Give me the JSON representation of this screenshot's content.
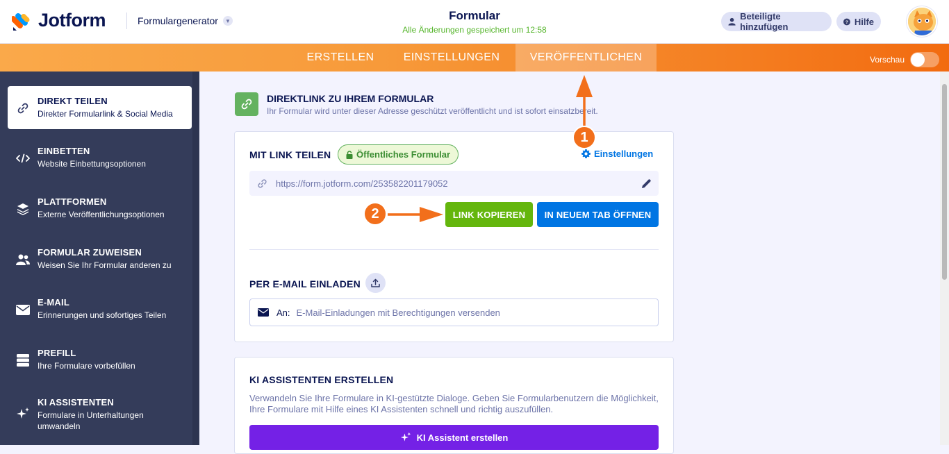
{
  "header": {
    "brand": "Jotform",
    "form_generator": "Formulargenerator",
    "title": "Formular",
    "saved_status": "Alle Änderungen gespeichert um 12:58",
    "add_participants": "Beteiligte hinzufügen",
    "help": "Hilfe"
  },
  "nav": {
    "tabs": [
      {
        "label": "ERSTELLEN"
      },
      {
        "label": "EINSTELLUNGEN"
      },
      {
        "label": "VERÖFFENTLICHEN"
      }
    ],
    "active_tab": "VERÖFFENTLICHEN",
    "preview_label": "Vorschau"
  },
  "sidebar": {
    "items": [
      {
        "title": "DIREKT TEILEN",
        "subtitle": "Direkter Formularlink & Social Media",
        "icon": "link-icon"
      },
      {
        "title": "EINBETTEN",
        "subtitle": "Website Einbettungsoptionen",
        "icon": "code-icon"
      },
      {
        "title": "PLATTFORMEN",
        "subtitle": "Externe Veröffentlichungsoptionen",
        "icon": "layers-icon"
      },
      {
        "title": "FORMULAR ZUWEISEN",
        "subtitle": "Weisen Sie Ihr Formular anderen zu",
        "icon": "users-icon"
      },
      {
        "title": "E-MAIL",
        "subtitle": "Erinnerungen und sofortiges Teilen",
        "icon": "envelope-icon"
      },
      {
        "title": "PREFILL",
        "subtitle": "Ihre Formulare vorbefüllen",
        "icon": "stack-icon"
      },
      {
        "title": "KI ASSISTENTEN",
        "subtitle": "Formulare in Unterhaltungen umwandeln",
        "icon": "sparkle-icon"
      }
    ]
  },
  "main": {
    "header_title": "DIREKTLINK ZU IHREM FORMULAR",
    "header_subtitle": "Ihr Formular wird unter dieser Adresse geschützt veröffentlicht und ist sofort einsatzbereit.",
    "share_title": "MIT LINK TEILEN",
    "public_badge": "Öffentliches Formular",
    "settings_link": "Einstellungen",
    "form_url": "https://form.jotform.com/253582201179052",
    "copy_link": "LINK KOPIEREN",
    "open_new_tab": "IN NEUEM TAB ÖFFNEN",
    "email_title": "PER E-MAIL EINLADEN",
    "email_to_label": "An:",
    "email_placeholder": "E-Mail-Einladungen mit Berechtigungen versenden",
    "ki_title": "KI ASSISTENTEN ERSTELLEN",
    "ki_description": "Verwandeln Sie Ihre Formulare in KI-gestützte Dialoge. Geben Sie Formularbenutzern die Möglichkeit, Ihre Formulare mit Hilfe eines KI Assistenten schnell und richtig auszufüllen.",
    "ki_button": "KI Assistent erstellen"
  },
  "annotations": {
    "step1": "1",
    "step2": "2"
  },
  "colors": {
    "orange_accent": "#f26f1b",
    "copy_button": "#64b60d",
    "open_button": "#0075e3",
    "ki_button": "#7421e6",
    "sidebar_bg": "#343c5a"
  }
}
